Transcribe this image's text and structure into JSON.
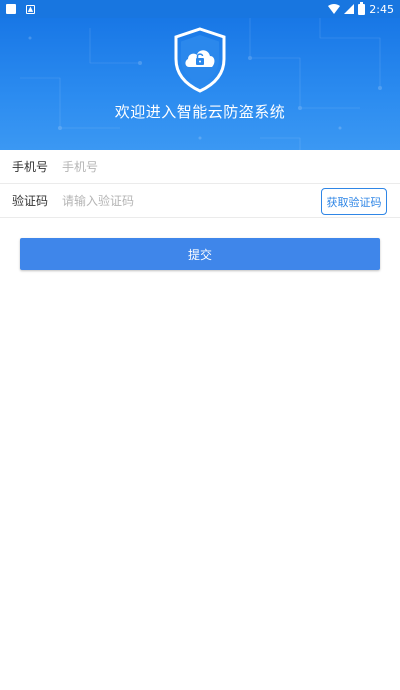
{
  "status_bar": {
    "time": "2:45",
    "icons": [
      "square-notification-icon",
      "photo-notification-icon",
      "wifi-icon",
      "signal-icon",
      "battery-icon"
    ]
  },
  "header": {
    "title": "欢迎进入智能云防盗系统",
    "logo_icon": "shield-cloud-lock-icon",
    "colors": {
      "gradient_top": "#1877e6",
      "gradient_bottom": "#3b98f3"
    }
  },
  "form": {
    "phone": {
      "label": "手机号",
      "placeholder": "手机号",
      "value": ""
    },
    "code": {
      "label": "验证码",
      "placeholder": "请输入验证码",
      "value": "",
      "get_code_label": "获取验证码"
    },
    "submit_label": "提交"
  },
  "colors": {
    "accent": "#3f86ea",
    "button_border": "#2f86e6"
  }
}
